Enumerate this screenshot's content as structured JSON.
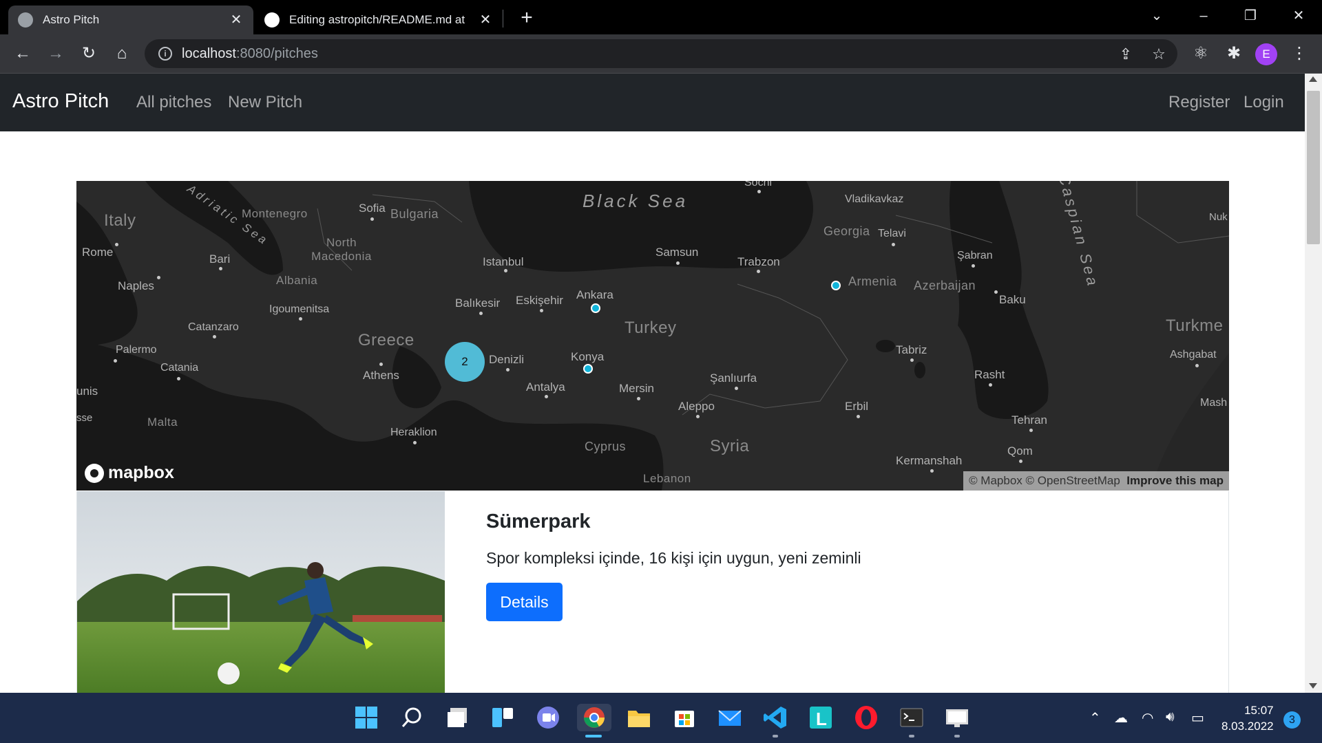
{
  "browser": {
    "tabs": [
      {
        "title": "Astro Pitch",
        "active": true
      },
      {
        "title": "Editing astropitch/README.md at",
        "active": false
      }
    ],
    "url_host": "localhost",
    "url_path": ":8080/pitches",
    "profile_initial": "E"
  },
  "navbar": {
    "brand": "Astro Pitch",
    "links": [
      "All pitches",
      "New Pitch"
    ],
    "right_links": [
      "Register",
      "Login"
    ]
  },
  "map": {
    "countries": [
      "Italy",
      "Montenegro",
      "Bulgaria",
      "North Macedonia",
      "Albania",
      "Greece",
      "Turkey",
      "Georgia",
      "Armenia",
      "Azerbaijan",
      "Syria",
      "Lebanon",
      "Cyprus",
      "Malta",
      "Turkme"
    ],
    "seas": [
      "Black Sea",
      "Adriatic Sea",
      "Caspian Sea"
    ],
    "cities": [
      "Rome",
      "Naples",
      "Bari",
      "Catanzaro",
      "Palermo",
      "Catania",
      "unis",
      "sse",
      "Sofia",
      "Igoumenitsa",
      "Athens",
      "Heraklion",
      "Istanbul",
      "Balıkesir",
      "Eskişehir",
      "Ankara",
      "Denizli",
      "Konya",
      "Antalya",
      "Mersin",
      "Samsun",
      "Trabzon",
      "Sochi",
      "Vladikavkaz",
      "Telavi",
      "Şabran",
      "Baku",
      "Şanlıurfa",
      "Aleppo",
      "Tabriz",
      "Rasht",
      "Erbil",
      "Tehran",
      "Qom",
      "Kermanshah",
      "Ashgabat",
      "Nuk",
      "Mash"
    ],
    "cluster_count": "2",
    "logo": "mapbox",
    "attribution": "© Mapbox © OpenStreetMap",
    "improve": "Improve this map"
  },
  "pitch": {
    "title": "Sümerpark",
    "description": "Spor kompleksi içinde, 16 kişi için uygun, yeni zeminli",
    "button": "Details"
  },
  "taskbar": {
    "time": "15:07",
    "date": "8.03.2022",
    "notifications": "3"
  },
  "colors": {
    "navbar": "#212529",
    "primary_button": "#0d6efd",
    "map_marker": "#11b4da",
    "cluster": "#51bbd6"
  }
}
